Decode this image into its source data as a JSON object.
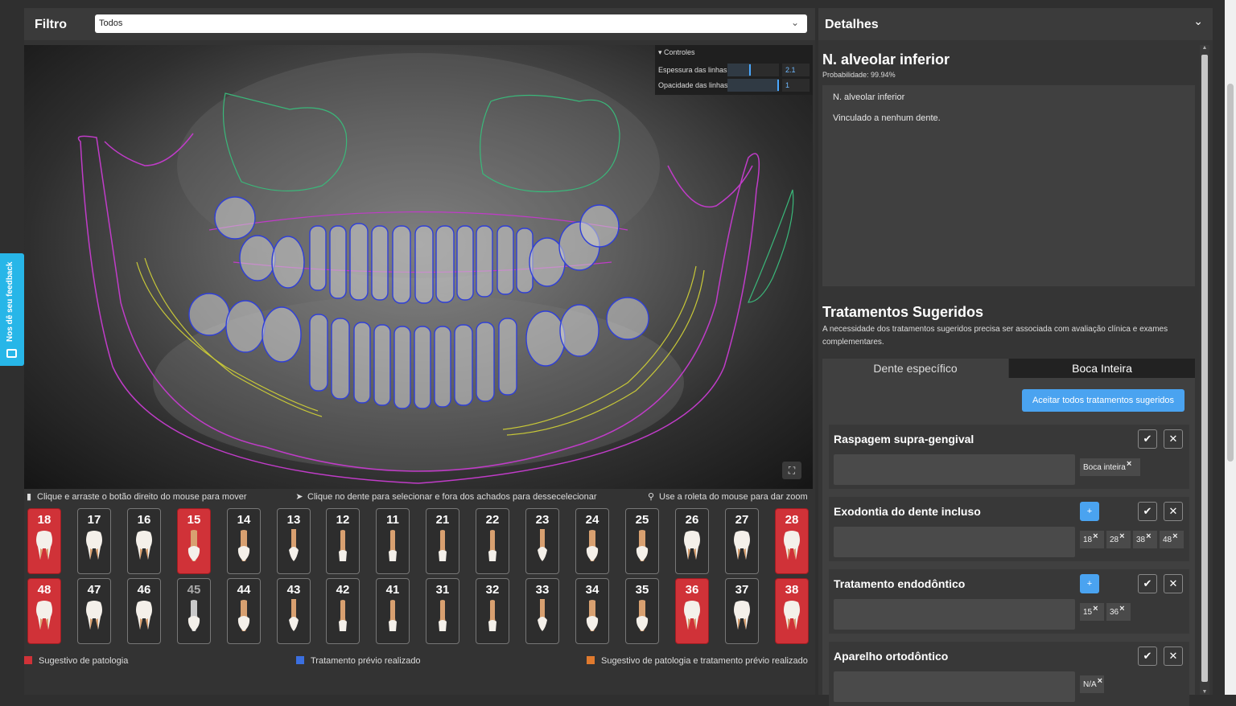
{
  "feedback": {
    "label": "Nos dê seu feedback"
  },
  "filter": {
    "label": "Filtro",
    "value": "Todos"
  },
  "controls": {
    "title": "Controles",
    "line_thickness": {
      "label": "Espessura das linhas",
      "value": "2.1",
      "fraction": 0.45
    },
    "line_opacity": {
      "label": "Opacidade das linhas",
      "value": "1",
      "fraction": 1.0
    }
  },
  "hints": {
    "move": "Clique e arraste o botão direito do mouse para mover",
    "select": "Clique no dente para selecionar e fora dos achados para dessecelecionar",
    "zoom": "Use a roleta do mouse para dar zoom"
  },
  "teeth_upper": [
    {
      "num": "18",
      "status": "pathology",
      "type": "molar"
    },
    {
      "num": "17",
      "status": "normal",
      "type": "molar"
    },
    {
      "num": "16",
      "status": "normal",
      "type": "molar"
    },
    {
      "num": "15",
      "status": "pathology",
      "type": "premolar"
    },
    {
      "num": "14",
      "status": "normal",
      "type": "premolar"
    },
    {
      "num": "13",
      "status": "normal",
      "type": "canine"
    },
    {
      "num": "12",
      "status": "normal",
      "type": "incisor"
    },
    {
      "num": "11",
      "status": "normal",
      "type": "incisor"
    },
    {
      "num": "21",
      "status": "normal",
      "type": "incisor"
    },
    {
      "num": "22",
      "status": "normal",
      "type": "incisor"
    },
    {
      "num": "23",
      "status": "normal",
      "type": "canine"
    },
    {
      "num": "24",
      "status": "normal",
      "type": "premolar"
    },
    {
      "num": "25",
      "status": "normal",
      "type": "premolar"
    },
    {
      "num": "26",
      "status": "normal",
      "type": "molar"
    },
    {
      "num": "27",
      "status": "normal",
      "type": "molar"
    },
    {
      "num": "28",
      "status": "pathology",
      "type": "molar"
    }
  ],
  "teeth_lower": [
    {
      "num": "48",
      "status": "pathology",
      "type": "molar"
    },
    {
      "num": "47",
      "status": "normal",
      "type": "molar"
    },
    {
      "num": "46",
      "status": "normal",
      "type": "molar"
    },
    {
      "num": "45",
      "status": "dim",
      "type": "premolar"
    },
    {
      "num": "44",
      "status": "normal",
      "type": "premolar"
    },
    {
      "num": "43",
      "status": "normal",
      "type": "canine"
    },
    {
      "num": "42",
      "status": "normal",
      "type": "incisor"
    },
    {
      "num": "41",
      "status": "normal",
      "type": "incisor"
    },
    {
      "num": "31",
      "status": "normal",
      "type": "incisor"
    },
    {
      "num": "32",
      "status": "normal",
      "type": "incisor"
    },
    {
      "num": "33",
      "status": "normal",
      "type": "canine"
    },
    {
      "num": "34",
      "status": "normal",
      "type": "premolar"
    },
    {
      "num": "35",
      "status": "normal",
      "type": "premolar"
    },
    {
      "num": "36",
      "status": "pathology",
      "type": "molar"
    },
    {
      "num": "37",
      "status": "normal",
      "type": "molar"
    },
    {
      "num": "38",
      "status": "pathology",
      "type": "molar"
    }
  ],
  "legend": {
    "pathology": {
      "label": "Sugestivo de patologia",
      "color": "#d03238"
    },
    "prior_treatment": {
      "label": "Tratamento prévio realizado",
      "color": "#3b6fe0"
    },
    "both": {
      "label": "Sugestivo de patologia e tratamento prévio realizado",
      "color": "#e07a2e"
    }
  },
  "details": {
    "header": "Detalhes",
    "finding_title": "N. alveolar inferior",
    "probability": "Probabilidade: 99.94%",
    "finding_name": "N. alveolar inferior",
    "finding_link": "Vinculado a nenhum dente."
  },
  "treatments": {
    "title": "Tratamentos Sugeridos",
    "note": "A necessidade dos tratamentos sugeridos precisa ser associada com avaliação clínica e exames complementares.",
    "tab_specific": "Dente específico",
    "tab_whole": "Boca Inteira",
    "accept_all": "Aceitar todos tratamentos sugeridos",
    "items": [
      {
        "name": "Raspagem supra-gengival",
        "has_add": false,
        "chips": [
          "Boca inteira"
        ]
      },
      {
        "name": "Exodontia do dente incluso",
        "has_add": true,
        "chips": [
          "18",
          "28",
          "38",
          "48"
        ]
      },
      {
        "name": "Tratamento endodôntico",
        "has_add": true,
        "chips": [
          "15",
          "36"
        ]
      },
      {
        "name": "Aparelho ortodôntico",
        "has_add": false,
        "chips": [
          "N/A"
        ]
      }
    ]
  },
  "icons": {
    "move": "mouse-icon",
    "select": "cursor-icon",
    "zoom": "magnifier-icon",
    "fullscreen": "fullscreen-icon",
    "accept": "check-icon",
    "reject": "close-icon",
    "add": "plus-icon"
  }
}
